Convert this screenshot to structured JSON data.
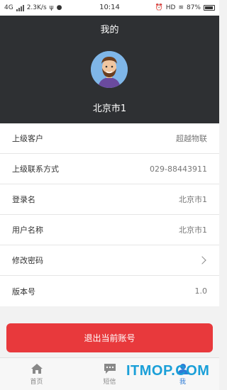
{
  "status_bar": {
    "network": "4G",
    "speed": "2.3K/s",
    "time": "10:14",
    "hd": "HD",
    "battery": "87%"
  },
  "header": {
    "title": "我的",
    "username": "北京市1"
  },
  "list": [
    {
      "label": "上级客户",
      "value": "超越物联"
    },
    {
      "label": "上级联系方式",
      "value": "029-88443911"
    },
    {
      "label": "登录名",
      "value": "北京市1"
    },
    {
      "label": "用户名称",
      "value": "北京市1"
    },
    {
      "label": "修改密码",
      "value": ""
    },
    {
      "label": "版本号",
      "value": "1.0"
    }
  ],
  "logout_label": "退出当前账号",
  "tabs": [
    {
      "label": "首页",
      "icon": "home-icon"
    },
    {
      "label": "短信",
      "icon": "message-icon"
    },
    {
      "label": "我",
      "icon": "user-icon"
    }
  ],
  "watermark": "ITMOP.COM",
  "colors": {
    "header_bg": "#2e3033",
    "logout_bg": "#e8393c",
    "active_tab": "#2d7bd6"
  }
}
